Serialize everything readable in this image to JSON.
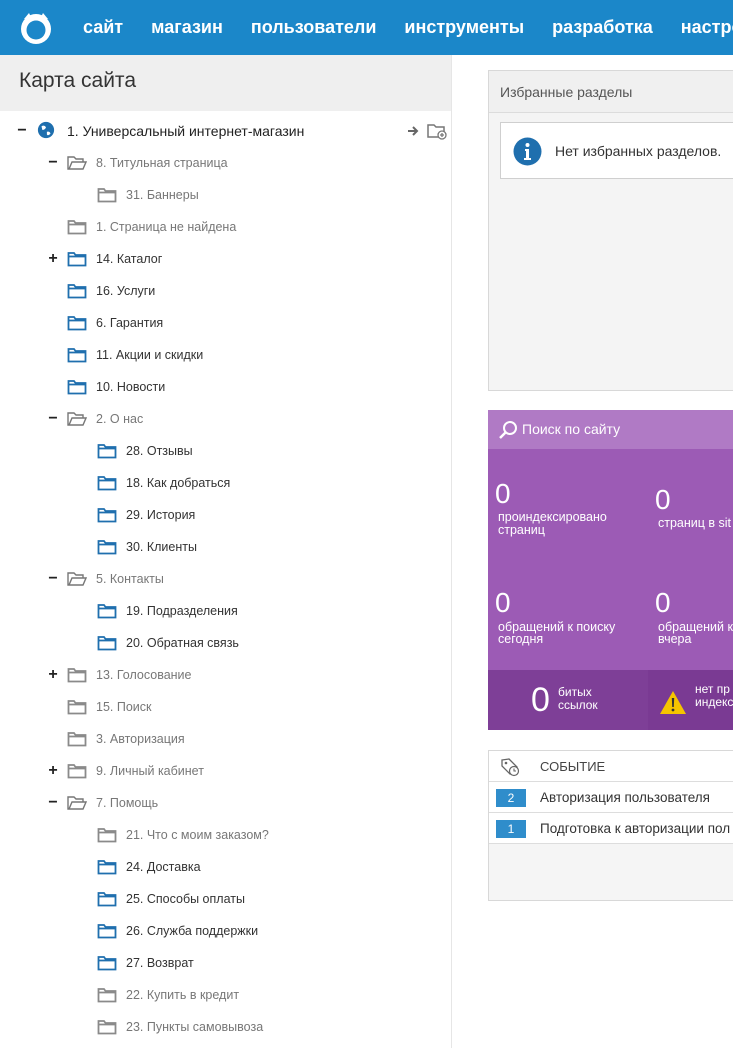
{
  "nav": {
    "items": [
      "сайт",
      "магазин",
      "пользователи",
      "инструменты",
      "разработка",
      "настройк"
    ]
  },
  "sitemap": {
    "title": "Карта сайта",
    "root": "1. Универсальный интернет-магазин",
    "nodes": [
      {
        "label": "8. Титульная страница",
        "level": 1,
        "toggle": "−",
        "icon": "folder-open",
        "active": false
      },
      {
        "label": "31. Баннеры",
        "level": 2,
        "toggle": "",
        "icon": "folder",
        "active": false
      },
      {
        "label": "1. Страница не найдена",
        "level": 1,
        "toggle": "",
        "icon": "folder",
        "active": false
      },
      {
        "label": "14. Каталог",
        "level": 1,
        "toggle": "+",
        "icon": "folder",
        "active": true
      },
      {
        "label": "16. Услуги",
        "level": 1,
        "toggle": "",
        "icon": "folder",
        "active": true
      },
      {
        "label": "6. Гарантия",
        "level": 1,
        "toggle": "",
        "icon": "folder",
        "active": true
      },
      {
        "label": "11. Акции и скидки",
        "level": 1,
        "toggle": "",
        "icon": "folder",
        "active": true
      },
      {
        "label": "10. Новости",
        "level": 1,
        "toggle": "",
        "icon": "folder",
        "active": true
      },
      {
        "label": "2. О нас",
        "level": 1,
        "toggle": "−",
        "icon": "folder-open",
        "active": false
      },
      {
        "label": "28. Отзывы",
        "level": 2,
        "toggle": "",
        "icon": "folder",
        "active": true
      },
      {
        "label": "18. Как добраться",
        "level": 2,
        "toggle": "",
        "icon": "folder",
        "active": true
      },
      {
        "label": "29. История",
        "level": 2,
        "toggle": "",
        "icon": "folder",
        "active": true
      },
      {
        "label": "30. Клиенты",
        "level": 2,
        "toggle": "",
        "icon": "folder",
        "active": true
      },
      {
        "label": "5. Контакты",
        "level": 1,
        "toggle": "−",
        "icon": "folder-open",
        "active": false
      },
      {
        "label": "19. Подразделения",
        "level": 2,
        "toggle": "",
        "icon": "folder",
        "active": true
      },
      {
        "label": "20. Обратная связь",
        "level": 2,
        "toggle": "",
        "icon": "folder",
        "active": true
      },
      {
        "label": "13. Голосование",
        "level": 1,
        "toggle": "+",
        "icon": "folder",
        "active": false
      },
      {
        "label": "15. Поиск",
        "level": 1,
        "toggle": "",
        "icon": "folder",
        "active": false
      },
      {
        "label": "3. Авторизация",
        "level": 1,
        "toggle": "",
        "icon": "folder",
        "active": false
      },
      {
        "label": "9. Личный кабинет",
        "level": 1,
        "toggle": "+",
        "icon": "folder",
        "active": false
      },
      {
        "label": "7. Помощь",
        "level": 1,
        "toggle": "−",
        "icon": "folder-open",
        "active": false
      },
      {
        "label": "21. Что с моим заказом?",
        "level": 2,
        "toggle": "",
        "icon": "folder",
        "active": false
      },
      {
        "label": "24. Доставка",
        "level": 2,
        "toggle": "",
        "icon": "folder",
        "active": true
      },
      {
        "label": "25. Способы оплаты",
        "level": 2,
        "toggle": "",
        "icon": "folder",
        "active": true
      },
      {
        "label": "26. Служба поддержки",
        "level": 2,
        "toggle": "",
        "icon": "folder",
        "active": true
      },
      {
        "label": "27. Возврат",
        "level": 2,
        "toggle": "",
        "icon": "folder",
        "active": true
      },
      {
        "label": "22. Купить в кредит",
        "level": 2,
        "toggle": "",
        "icon": "folder",
        "active": false
      },
      {
        "label": "23. Пункты самовывоза",
        "level": 2,
        "toggle": "",
        "icon": "folder",
        "active": false
      }
    ]
  },
  "favorites": {
    "title": "Избранные разделы",
    "empty_message": "Нет избранных разделов."
  },
  "search": {
    "title": "Поиск по сайту",
    "indexed_count": "0",
    "indexed_label_1": "проиндексировано",
    "indexed_label_2": "страниц",
    "sitemap_count": "0",
    "sitemap_label": "страниц в sit",
    "today_count": "0",
    "today_label_1": "обращений к поиску",
    "today_label_2": "сегодня",
    "yesterday_count": "0",
    "yesterday_label_1": "обращений к",
    "yesterday_label_2": "вчера",
    "broken_count": "0",
    "broken_label_1": "битых",
    "broken_label_2": "ссылок",
    "noindex_label_1": "нет пр",
    "noindex_label_2": "индекс"
  },
  "events": {
    "header": "СОБЫТИЕ",
    "rows": [
      {
        "count": "2",
        "text": "Авторизация пользователя"
      },
      {
        "count": "1",
        "text": "Подготовка к авторизации пол"
      }
    ]
  },
  "colors": {
    "topbar": "#1b87c9",
    "folder_active": "#1f6fae",
    "folder_inactive": "#8a8a8a",
    "search_panel": "#9c5bb5",
    "badge": "#2f8dcb"
  }
}
